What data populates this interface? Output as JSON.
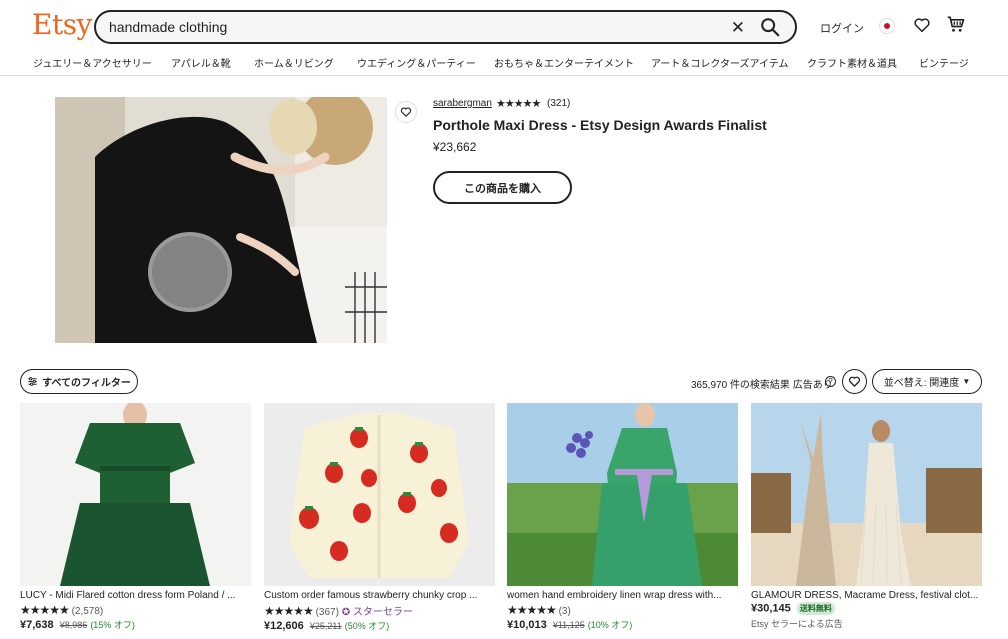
{
  "header": {
    "logo": "Etsy",
    "search_value": "handmade clothing",
    "login_label": "ログイン",
    "categories": [
      "ジュエリー＆アクセサリー",
      "アパレル＆靴",
      "ホーム＆リビング",
      "ウエディング＆パーティー",
      "おもちゃ＆エンターテイメント",
      "アート＆コレクターズアイテム",
      "クラフト素材＆道具",
      "ビンテージ"
    ]
  },
  "hero": {
    "seller": "sarabergman",
    "stars": "★★★★★",
    "review_count": "(321)",
    "title": "Porthole Maxi Dress - Etsy Design Awards Finalist",
    "price": "¥23,662",
    "buy_label": "この商品を購入"
  },
  "toolbar": {
    "filter_label": "すべてのフィルター",
    "results_text": "365,970 件の検索結果 広告あり",
    "sort_label": "並べ替え: 関連度"
  },
  "products": [
    {
      "title": "LUCY - Midi Flared cotton dress form Poland / ...",
      "stars": "★★★★★",
      "reviews": "(2,578)",
      "price": "¥7,638",
      "original_price": "¥8,986",
      "discount": "(15% オフ)"
    },
    {
      "title": "Custom order famous strawberry chunky crop ...",
      "stars": "★★★★★",
      "reviews": "(367)",
      "badge": "スターセラー",
      "price": "¥12,606",
      "original_price": "¥25,211",
      "discount": "(50% オフ)"
    },
    {
      "title": "women hand embroidery linen wrap dress with...",
      "stars": "★★★★★",
      "reviews": "(3)",
      "price": "¥10,013",
      "original_price": "¥11,125",
      "discount": "(10% オフ)"
    },
    {
      "title": "GLAMOUR DRESS, Macrame Dress, festival clot...",
      "price": "¥30,145",
      "free_shipping": "送料無料",
      "ad_label": "Etsy セラーによる広告"
    }
  ]
}
